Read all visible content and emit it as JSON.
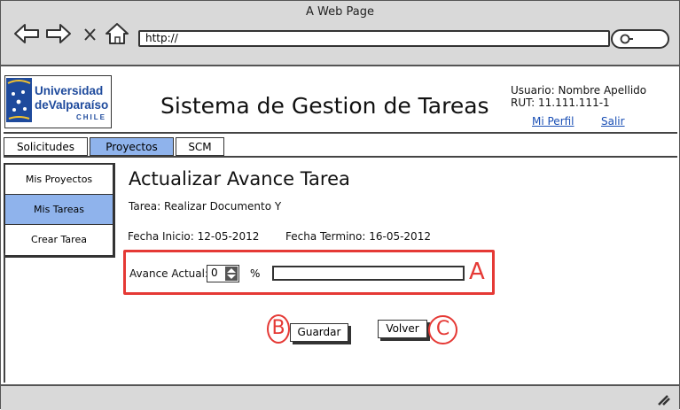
{
  "browser": {
    "window_title": "A Web Page",
    "url": "http://"
  },
  "header": {
    "logo": {
      "line1": "Universidad",
      "line2": "deValparaíso",
      "line3": "CHILE"
    },
    "title": "Sistema de Gestion de Tareas",
    "user_line": "Usuario: Nombre Apellido",
    "rut_line": "RUT: 11.111.111-1",
    "profile_link": "Mi Perfil",
    "logout_link": "Salir"
  },
  "tabs": [
    {
      "label": "Solicitudes",
      "active": false
    },
    {
      "label": "Proyectos",
      "active": true
    },
    {
      "label": "SCM",
      "active": false
    }
  ],
  "sidebar": {
    "items": [
      {
        "label": "Mis Proyectos",
        "active": false
      },
      {
        "label": "Mis Tareas",
        "active": true
      },
      {
        "label": "Crear Tarea",
        "active": false
      }
    ]
  },
  "main": {
    "heading": "Actualizar Avance Tarea",
    "task_line": "Tarea: Realizar Documento Y",
    "start_date": "Fecha Inicio: 12-05-2012",
    "end_date": "Fecha Termino: 16-05-2012",
    "progress_label": "Avance Actual:",
    "progress_value": "0",
    "progress_unit": "%",
    "progress_fraction": 0,
    "save_button": "Guardar",
    "back_button": "Volver"
  },
  "annotations": {
    "a": "A",
    "b": "B",
    "c": "C"
  },
  "colors": {
    "accent_blue": "#8fb3ec",
    "callout_red": "#e53935",
    "logo_blue": "#1e4a9c"
  }
}
